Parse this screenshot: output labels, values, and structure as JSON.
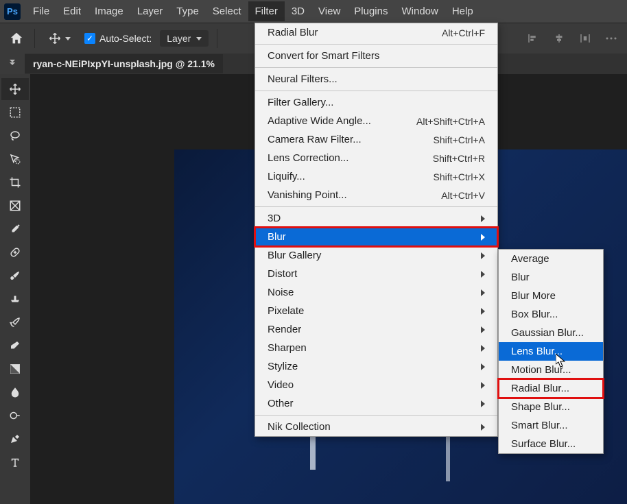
{
  "menubar": {
    "items": [
      "File",
      "Edit",
      "Image",
      "Layer",
      "Type",
      "Select",
      "Filter",
      "3D",
      "View",
      "Plugins",
      "Window",
      "Help"
    ],
    "active": "Filter"
  },
  "options": {
    "auto_select_label": "Auto-Select:",
    "layer_dropdown": "Layer"
  },
  "tab": {
    "title": "ryan-c-NEiPIxpYI-unsplash.jpg @ 21.1%"
  },
  "filter_menu": {
    "recent": {
      "label": "Radial Blur",
      "shortcut": "Alt+Ctrl+F"
    },
    "convert": "Convert for Smart Filters",
    "neural": "Neural Filters...",
    "group_gallery": [
      {
        "label": "Filter Gallery...",
        "shortcut": ""
      },
      {
        "label": "Adaptive Wide Angle...",
        "shortcut": "Alt+Shift+Ctrl+A"
      },
      {
        "label": "Camera Raw Filter...",
        "shortcut": "Shift+Ctrl+A"
      },
      {
        "label": "Lens Correction...",
        "shortcut": "Shift+Ctrl+R"
      },
      {
        "label": "Liquify...",
        "shortcut": "Shift+Ctrl+X"
      },
      {
        "label": "Vanishing Point...",
        "shortcut": "Alt+Ctrl+V"
      }
    ],
    "submenus": [
      "3D",
      "Blur",
      "Blur Gallery",
      "Distort",
      "Noise",
      "Pixelate",
      "Render",
      "Sharpen",
      "Stylize",
      "Video",
      "Other"
    ],
    "nik": "Nik Collection",
    "highlighted": "Blur"
  },
  "blur_submenu": {
    "items": [
      "Average",
      "Blur",
      "Blur More",
      "Box Blur...",
      "Gaussian Blur...",
      "Lens Blur...",
      "Motion Blur...",
      "Radial Blur...",
      "Shape Blur...",
      "Smart Blur...",
      "Surface Blur..."
    ],
    "highlighted": "Lens Blur...",
    "redboxed": "Radial Blur..."
  },
  "tools": [
    "move",
    "marquee",
    "lasso",
    "wand",
    "crop",
    "frame",
    "eyedropper",
    "heal",
    "brush",
    "stamp",
    "history",
    "eraser",
    "gradient",
    "blur",
    "dodge",
    "pen",
    "type"
  ]
}
